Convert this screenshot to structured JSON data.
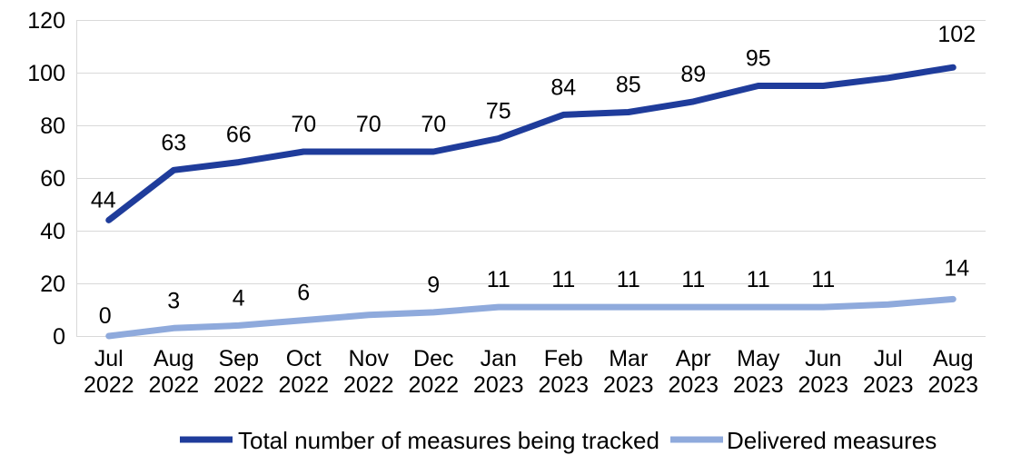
{
  "chart_data": {
    "type": "line",
    "title": "",
    "subtitle": "",
    "xlabel": "",
    "ylabel": "",
    "ylim": [
      0,
      120
    ],
    "ytick_step": 20,
    "ytick_labels": [
      "0",
      "20",
      "40",
      "60",
      "80",
      "100",
      "120"
    ],
    "grid": true,
    "legend_position": "bottom",
    "categories": [
      "Jul\n2022",
      "Aug\n2022",
      "Sep\n2022",
      "Oct\n2022",
      "Nov\n2022",
      "Dec\n2022",
      "Jan\n2023",
      "Feb\n2023",
      "Mar\n2023",
      "Apr\n2023",
      "May\n2023",
      "Jun\n2023",
      "Jul\n2023",
      "Aug\n2023"
    ],
    "category_months": [
      "Jul",
      "Aug",
      "Sep",
      "Oct",
      "Nov",
      "Dec",
      "Jan",
      "Feb",
      "Mar",
      "Apr",
      "May",
      "Jun",
      "Jul",
      "Aug"
    ],
    "category_years": [
      "2022",
      "2022",
      "2022",
      "2022",
      "2022",
      "2022",
      "2023",
      "2023",
      "2023",
      "2023",
      "2023",
      "2023",
      "2023",
      "2023"
    ],
    "series": [
      {
        "name": "Total number of measures being tracked",
        "color": "#1F3C9B",
        "values": [
          44,
          63,
          66,
          70,
          70,
          70,
          75,
          84,
          85,
          89,
          95,
          95,
          98,
          102
        ],
        "labels": [
          "44",
          "63",
          "66",
          "70",
          "70",
          "70",
          "75",
          "84",
          "85",
          "89",
          "95",
          "",
          "",
          "102"
        ]
      },
      {
        "name": "Delivered measures",
        "color": "#8FAADC",
        "values": [
          0,
          3,
          4,
          6,
          8,
          9,
          11,
          11,
          11,
          11,
          11,
          11,
          12,
          14
        ],
        "labels": [
          "0",
          "3",
          "4",
          "6",
          "",
          "9",
          "11",
          "11",
          "11",
          "11",
          "11",
          "11",
          "",
          "14"
        ]
      }
    ]
  },
  "legend": {
    "entries": [
      {
        "label": "Total number of measures being tracked",
        "color": "#1F3C9B"
      },
      {
        "label": "Delivered measures",
        "color": "#8FAADC"
      }
    ]
  },
  "colors": {
    "series_dark_blue": "#1F3C9B",
    "series_light_blue": "#8FAADC",
    "gridline": "#D9D9D9",
    "text": "#000000",
    "background": "#FFFFFF"
  }
}
